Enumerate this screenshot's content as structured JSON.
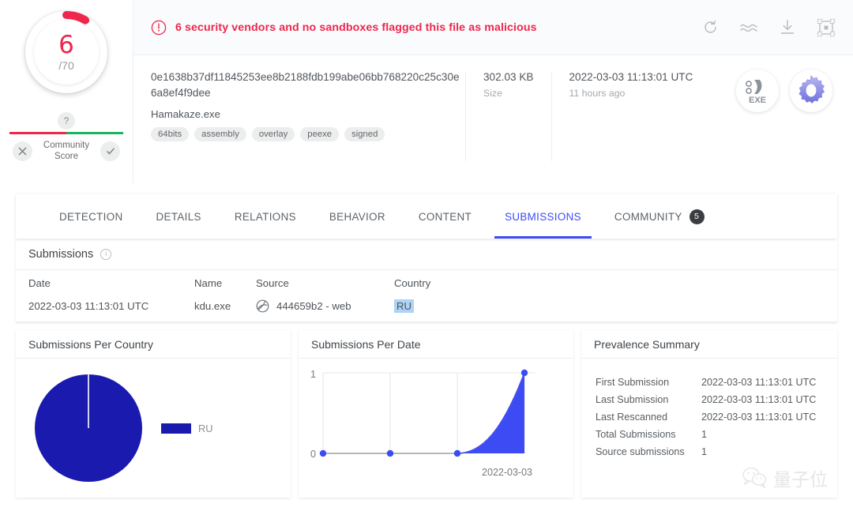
{
  "score": {
    "value": "6",
    "total": "/70",
    "arc_color": "#f0264d",
    "arc_fraction": 0.0857
  },
  "community": {
    "help": "?",
    "label_line1": "Community",
    "label_line2": "Score",
    "reject_icon": "x-icon",
    "accept_icon": "check-icon"
  },
  "alert": {
    "icon": "exclamation-circle-icon",
    "text": "6 security vendors and no sandboxes flagged this file as malicious"
  },
  "actions": [
    {
      "name": "reanalyze-icon",
      "title": "Reanalyze"
    },
    {
      "name": "similar-icon",
      "title": "Similar"
    },
    {
      "name": "download-icon",
      "title": "Download"
    },
    {
      "name": "graph-icon",
      "title": "Graph"
    }
  ],
  "file": {
    "hash": "0e1638b37df11845253ee8b2188fdb199abe06bb768220c25c30e6a8ef4f9dee",
    "name": "Hamakaze.exe",
    "tags": [
      "64bits",
      "assembly",
      "overlay",
      "peexe",
      "signed"
    ],
    "size_value": "302.03 KB",
    "size_label": "Size",
    "date_value": "2022-03-03 11:13:01 UTC",
    "date_label": "11 hours ago",
    "type_icon_label": "EXE",
    "type_icons": [
      "exe-icon",
      "gear-icon"
    ]
  },
  "tabs": [
    {
      "label": "DETECTION",
      "active": false
    },
    {
      "label": "DETAILS",
      "active": false
    },
    {
      "label": "RELATIONS",
      "active": false
    },
    {
      "label": "BEHAVIOR",
      "active": false
    },
    {
      "label": "CONTENT",
      "active": false
    },
    {
      "label": "SUBMISSIONS",
      "active": true
    },
    {
      "label": "COMMUNITY",
      "active": false,
      "badge": "5"
    }
  ],
  "submissions": {
    "title": "Submissions",
    "columns": [
      "Date",
      "Name",
      "Source",
      "Country"
    ],
    "rows": [
      {
        "date": "2022-03-03 11:13:01 UTC",
        "name": "kdu.exe",
        "source_icon": "web-globe-icon",
        "source": "444659b2 - web",
        "country": "RU"
      }
    ]
  },
  "cards": {
    "country_title": "Submissions Per Country",
    "date_title": "Submissions Per Date",
    "prevalence_title": "Prevalence Summary"
  },
  "prevalence": [
    {
      "key": "First Submission",
      "value": "2022-03-03 11:13:01 UTC"
    },
    {
      "key": "Last Submission",
      "value": "2022-03-03 11:13:01 UTC"
    },
    {
      "key": "Last Rescanned",
      "value": "2022-03-03 11:13:01 UTC"
    },
    {
      "key": "Total Submissions",
      "value": "1"
    },
    {
      "key": "Source submissions",
      "value": "1"
    }
  ],
  "watermark": {
    "text": "量子位",
    "icon": "wechat-icon"
  },
  "chart_data": [
    {
      "type": "pie",
      "title": "Submissions Per Country",
      "labels": [
        "RU"
      ],
      "values": [
        1
      ],
      "percentages": [
        100
      ],
      "colors": [
        "#1a1aae"
      ],
      "legend_position": "right"
    },
    {
      "type": "area",
      "title": "Submissions Per Date",
      "x": [
        "",
        "",
        "",
        "2022-03-03"
      ],
      "values": [
        0,
        0,
        0,
        1
      ],
      "ylim": [
        0,
        1
      ],
      "yticks": [
        "0",
        "1"
      ],
      "xtick_labels": [
        "2022-03-03"
      ],
      "color": "#3d4bf5",
      "grid": true
    }
  ]
}
